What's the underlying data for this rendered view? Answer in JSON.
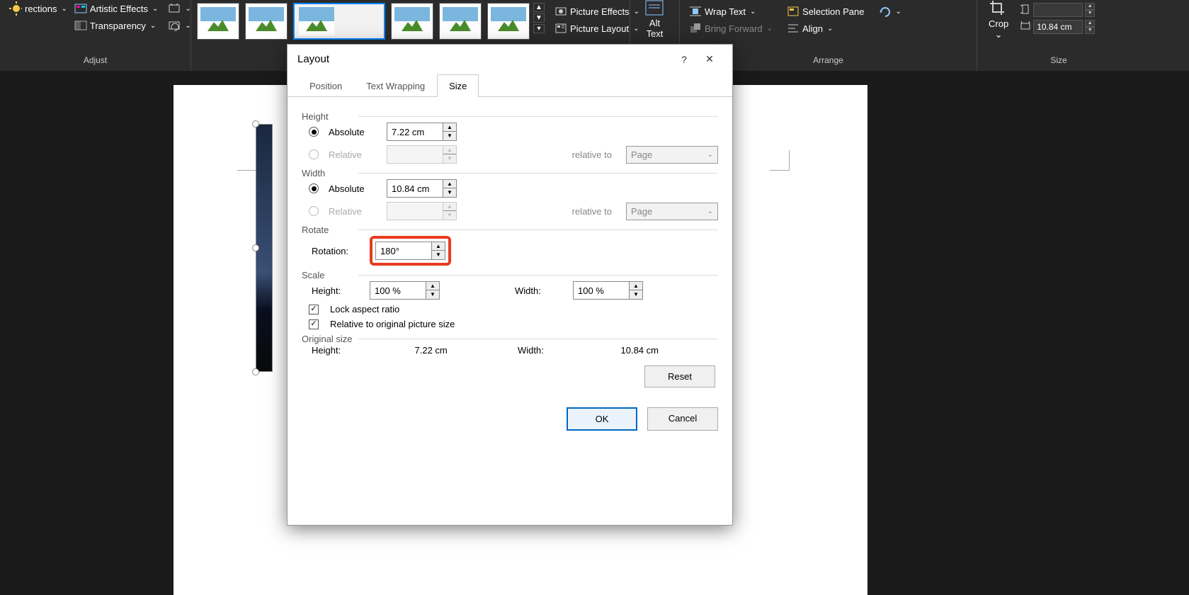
{
  "ribbon": {
    "adjust": {
      "corrections": "rections",
      "artistic": "Artistic Effects",
      "transparency": "Transparency",
      "group": "Adjust"
    },
    "picstyles": {
      "effects": "Picture Effects",
      "layout": "Picture Layout"
    },
    "alttext": {
      "line1": "Alt",
      "line2": "Text"
    },
    "arrange": {
      "wrap": "Wrap Text",
      "forward": "Bring Forward",
      "selpane": "Selection Pane",
      "align": "Align",
      "group": "Arrange"
    },
    "size": {
      "crop": "Crop",
      "width_val": "10.84 cm",
      "group": "Size"
    }
  },
  "dialog": {
    "title": "Layout",
    "tabs": {
      "position": "Position",
      "wrap": "Text Wrapping",
      "size": "Size"
    },
    "height": {
      "label": "Height",
      "absolute": "Absolute",
      "abs_val": "7.22 cm",
      "relative": "Relative",
      "relto": "relative to",
      "relto_val": "Page"
    },
    "width": {
      "label": "Width",
      "absolute": "Absolute",
      "abs_val": "10.84 cm",
      "relative": "Relative",
      "relto": "relative to",
      "relto_val": "Page"
    },
    "rotate": {
      "label": "Rotate",
      "rotation": "Rotation:",
      "val": "180°"
    },
    "scale": {
      "label": "Scale",
      "height": "Height:",
      "h_val": "100 %",
      "width": "Width:",
      "w_val": "100 %",
      "lock": "Lock aspect ratio",
      "rel": "Relative to original picture size"
    },
    "orig": {
      "label": "Original size",
      "height": "Height:",
      "h_val": "7.22 cm",
      "width": "Width:",
      "w_val": "10.84 cm"
    },
    "reset": "Reset",
    "ok": "OK",
    "cancel": "Cancel"
  }
}
